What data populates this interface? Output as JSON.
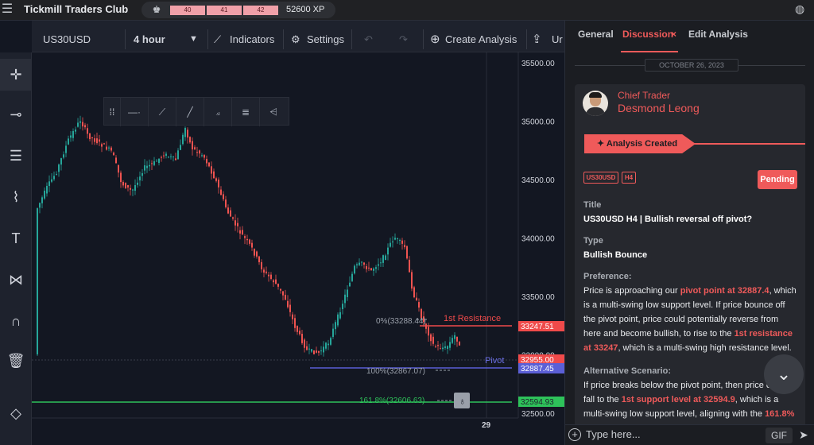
{
  "app": {
    "brand": "Tickmill Traders Club",
    "xp": "52600 XP",
    "levels": [
      "40",
      "41",
      "42"
    ]
  },
  "toolbar": {
    "symbol": "US30USD",
    "timeframe": "4 hour",
    "indicators": "Indicators",
    "settings": "Settings",
    "create_analysis": "Create Analysis",
    "upload_partial": "Ur"
  },
  "left_tools": [
    "crosshair-icon",
    "horizontal-line-icon",
    "fib-icon",
    "brush-icon",
    "text-icon",
    "pattern-icon",
    "magnet-icon",
    "trash-icon",
    "layers-icon"
  ],
  "chart": {
    "price_axis": [
      "35500.00",
      "35000.00",
      "34500.00",
      "34000.00",
      "33500.00",
      "33000.00",
      "32500.00"
    ],
    "time_label": "29",
    "labels": {
      "resistance": "1st Resistance",
      "pivot": "Pivot",
      "fib0": "0%(33288.44)",
      "fib100": "100%(32867.07)",
      "fib161": "161.8%(32606.63)"
    },
    "price_tags": {
      "resistance": "33247.51",
      "current": "32955.00",
      "pivot": "32887.45",
      "support": "32594.93"
    }
  },
  "panel": {
    "tabs": [
      "General",
      "Discussion",
      "Edit Analysis"
    ],
    "date": "OCTOBER 26, 2023",
    "author_role": "Chief Trader",
    "author_name": "Desmond Leong",
    "banner": "Analysis Created",
    "badges": [
      "US30USD",
      "H4"
    ],
    "status": "Pending",
    "title_label": "Title",
    "title": "US30USD H4 | Bullish reversal off pivot?",
    "type_label": "Type",
    "type": "Bullish Bounce",
    "preference_label": "Preference:",
    "preference": {
      "p1": "Price is approaching our ",
      "h1": "pivot point at 32887.4",
      "p2": ", which is a multi-swing low support level. If price bounce off the pivot point, price could potentially reverse from here and become bullish, to rise to the ",
      "h2": "1st resistance at 33247",
      "p3": ", which is a multi-swing high resistance level."
    },
    "alt_label": "Alternative Scenario:",
    "alt": {
      "p1": "If price breaks below the pivot point, then price could fall to the ",
      "h1": "1st support level at 32594.9",
      "p2": ", which is a multi-swing low support level, aligning with the ",
      "h2": "161.8%"
    },
    "input_placeholder": "Type here...",
    "gif": "GIF"
  }
}
